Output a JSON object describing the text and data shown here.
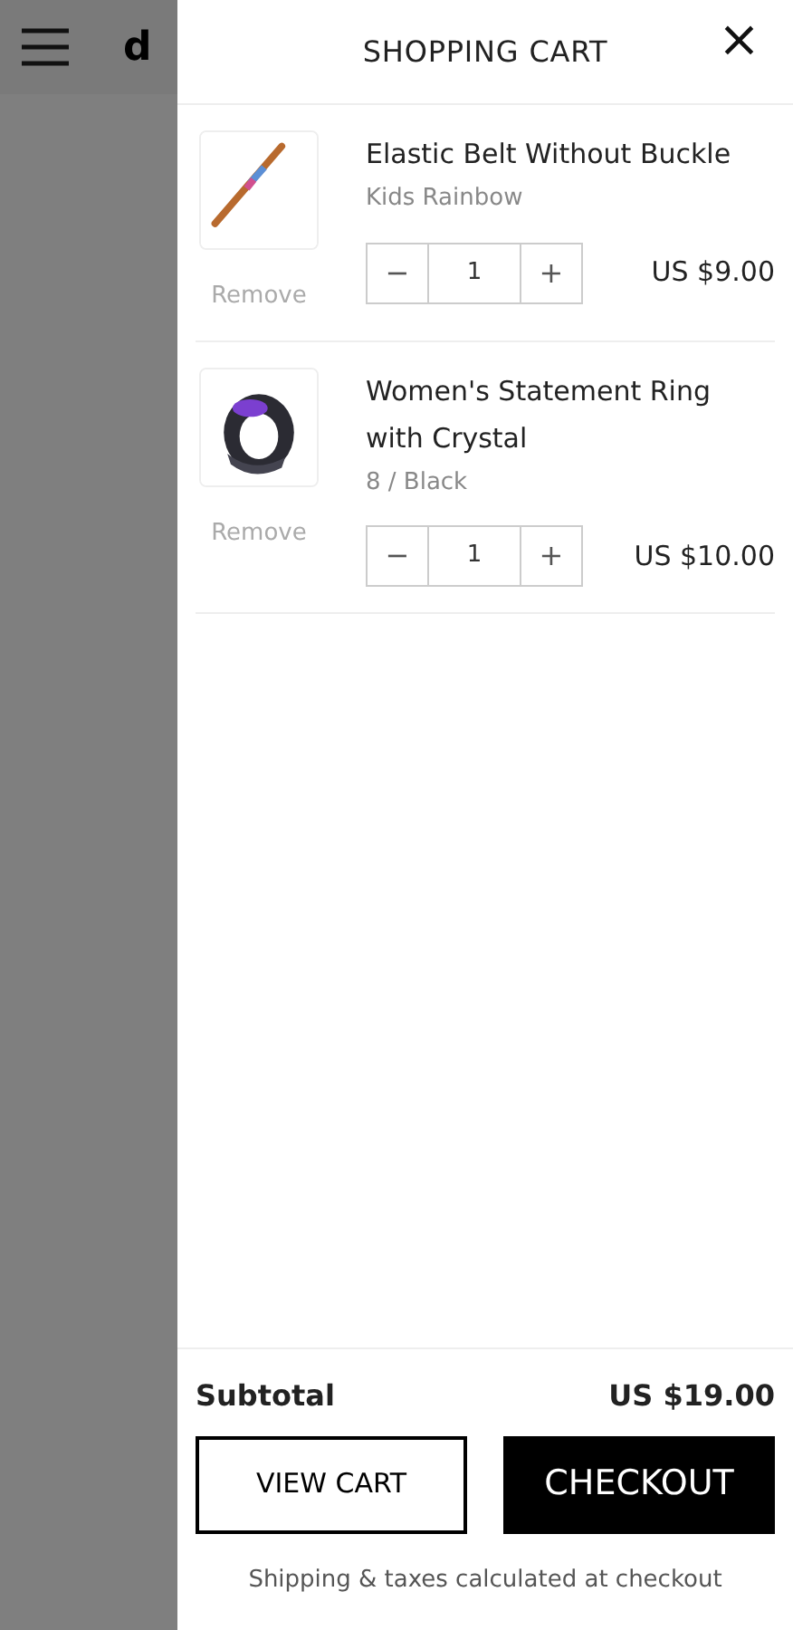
{
  "background": {
    "logo": "d"
  },
  "cart": {
    "title": "SHOPPING CART",
    "close": "×",
    "items": [
      {
        "name": "Elastic Belt Without Buckle",
        "variant": "Kids Rainbow",
        "remove": "Remove",
        "minus": "−",
        "quantity": "1",
        "plus": "+",
        "price": "US $9.00",
        "kind": "belt"
      },
      {
        "name": "Women's Statement Ring with Crystal",
        "variant": "8 / Black",
        "remove": "Remove",
        "minus": "−",
        "quantity": "1",
        "plus": "+",
        "price": "US $10.00",
        "kind": "ring"
      }
    ],
    "subtotal_label": "Subtotal",
    "subtotal": "US $19.00",
    "view_cart": "VIEW CART",
    "checkout": "CHECKOUT",
    "note": "Shipping & taxes calculated at checkout"
  }
}
